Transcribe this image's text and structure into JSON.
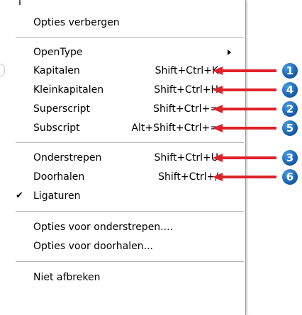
{
  "menu": {
    "items": [
      {
        "label": "Opties verbergen",
        "shortcut": ""
      },
      {
        "label": "OpenType",
        "shortcut": ""
      },
      {
        "label": "Kapitalen",
        "shortcut": "Shift+Ctrl+K"
      },
      {
        "label": "Kleinkapitalen",
        "shortcut": "Shift+Ctrl+H"
      },
      {
        "label": "Superscript",
        "shortcut": "Shift+Ctrl+="
      },
      {
        "label": "Subscript",
        "shortcut": "Alt+Shift+Ctrl+="
      },
      {
        "label": "Onderstrepen",
        "shortcut": "Shift+Ctrl+U"
      },
      {
        "label": "Doorhalen",
        "shortcut": "Shift+Ctrl+/"
      },
      {
        "label": "Ligaturen",
        "shortcut": "",
        "checked": true
      },
      {
        "label": "Opties voor onderstrepen....",
        "shortcut": ""
      },
      {
        "label": "Opties voor doorhalen...",
        "shortcut": ""
      },
      {
        "label": "Niet afbreken",
        "shortcut": ""
      }
    ]
  },
  "callouts": {
    "kapitalen": "1",
    "kleinkapitalen": "4",
    "superscript": "2",
    "subscript": "5",
    "onderstrepen": "3",
    "doorhalen": "6"
  },
  "colors": {
    "arrow": "#e0202a",
    "badge": "#1d66b5"
  },
  "icons": {
    "submenu": "submenu-arrow-icon",
    "check": "checkmark-icon"
  }
}
